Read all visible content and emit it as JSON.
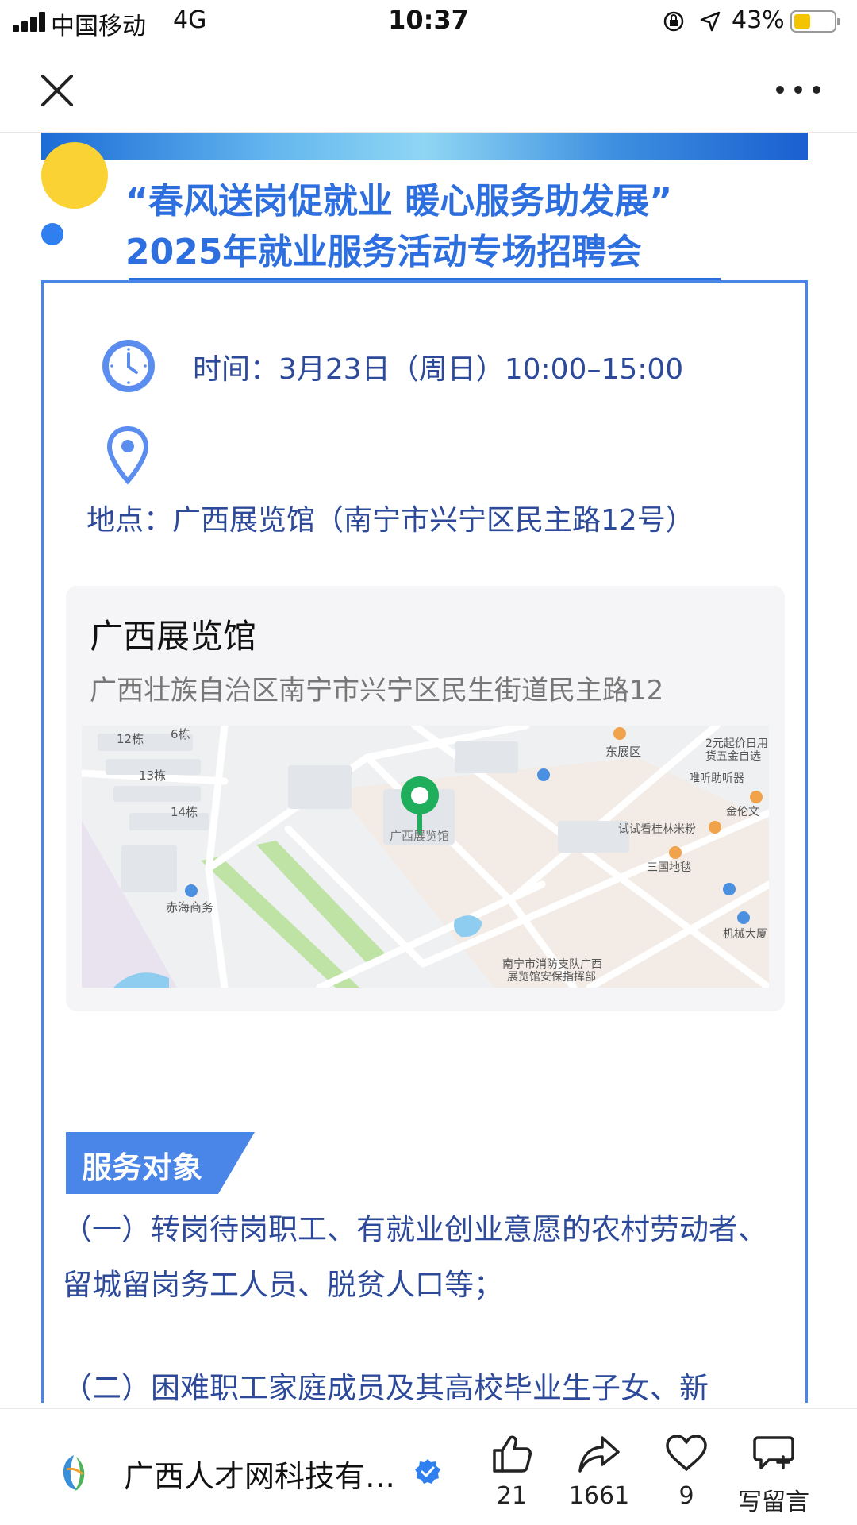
{
  "status_bar": {
    "carrier": "中国移动",
    "network": "4G",
    "time": "10:37",
    "battery_percent": "43%",
    "battery_level": 0.43,
    "battery_color": "#f5c400"
  },
  "nav": {
    "close_icon": "close-icon",
    "more_icon": "more-dots-icon"
  },
  "article": {
    "title_line1": "“春风送岗促就业 暖心服务助发展”",
    "title_line2": "2025年就业服务活动专场招聘会",
    "time_text": "时间：3月23日（周日）10:00–15:00",
    "place_text": "地点：广西展览馆（南宁市兴宁区民主路12号）",
    "map": {
      "name": "广西展览馆",
      "address": "广西壮族自治区南宁市兴宁区民生街道民主路12",
      "labels": {
        "b12": "12栋",
        "b6": "6栋",
        "b13": "13栋",
        "b14": "14栋",
        "center": "广西展览馆",
        "east_hall": "东展区",
        "shop1": "2元起价日用",
        "shop2": "货五金自选",
        "weiting": "唯听助听器",
        "jinlun": "金伦文",
        "shishi": "试试看桂林米粉",
        "sanguo": "三国地毯",
        "chihai": "赤海商务",
        "fire1": "南宁市消防支队广西",
        "fire2": "展览馆安保指挥部",
        "jixie": "机械大厦"
      }
    },
    "section_label": "服务对象",
    "para1": "（一）转岗待岗职工、有就业创业意愿的农村劳动者、留城留岗务工人员、脱贫人口等；",
    "para2": "（二）困难职工家庭成员及其高校毕业生子女、新"
  },
  "bottom_bar": {
    "account_name": "广西人才网科技有…",
    "like_count": "21",
    "share_count": "1661",
    "heart_count": "9",
    "comment_label": "写留言"
  },
  "colors": {
    "accent_blue": "#2e6fe0",
    "text_blue": "#2d4a9a",
    "deco_yellow": "#fbd234",
    "map_pin_green": "#1fae5b"
  }
}
